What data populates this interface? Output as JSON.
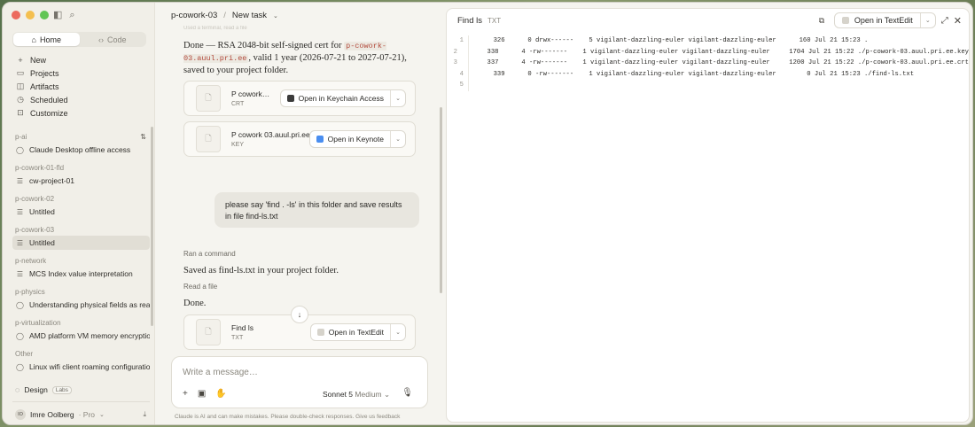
{
  "sidebar": {
    "tabs": {
      "home": "Home",
      "code": "Code"
    },
    "nav": [
      {
        "icon": "plus-icon",
        "glyph": "+",
        "label": "New"
      },
      {
        "icon": "folder-icon",
        "glyph": "▭",
        "label": "Projects"
      },
      {
        "icon": "artifacts-icon",
        "glyph": "◫",
        "label": "Artifacts"
      },
      {
        "icon": "clock-icon",
        "glyph": "◷",
        "label": "Scheduled"
      },
      {
        "icon": "customize-icon",
        "glyph": "⊡",
        "label": "Customize"
      }
    ],
    "groups": [
      {
        "label": "p-ai",
        "items": [
          {
            "icon": "chat-icon",
            "label": "Claude Desktop offline access"
          }
        ]
      },
      {
        "label": "p-cowork-01-fld",
        "items": [
          {
            "icon": "task-icon",
            "label": "cw-project-01"
          }
        ]
      },
      {
        "label": "p-cowork-02",
        "items": [
          {
            "icon": "task-icon",
            "label": "Untitled"
          }
        ]
      },
      {
        "label": "p-cowork-03",
        "items": [
          {
            "icon": "task-icon",
            "label": "Untitled",
            "selected": true
          }
        ]
      },
      {
        "label": "p-network",
        "items": [
          {
            "icon": "task-icon",
            "label": "MCS Index value interpretation"
          }
        ]
      },
      {
        "label": "p-physics",
        "items": [
          {
            "icon": "chat-icon",
            "label": "Understanding physical fields as real"
          }
        ]
      },
      {
        "label": "p-virtualization",
        "items": [
          {
            "icon": "chat-icon",
            "label": "AMD platform VM memory encryption"
          }
        ]
      },
      {
        "label": "Other",
        "items": [
          {
            "icon": "chat-icon",
            "label": "Linux wifi client roaming configuration"
          }
        ]
      }
    ],
    "design": {
      "label": "Design",
      "badge": "Labs"
    },
    "user": {
      "initials": "IO",
      "name": "Imre Oolberg",
      "plan": "· Pro"
    }
  },
  "chat": {
    "breadcrumb": {
      "project": "p-cowork-03",
      "separator": "/",
      "task": "New task"
    },
    "faded_top": "Used a terminal, read a file",
    "reply1": {
      "text_a": "Done — RSA 2048-bit self-signed cert for ",
      "code": "p-cowork-03.auul.pri.ee",
      "text_b": ", valid 1 year (2026-07-21 to 2027-07-21), saved to your project folder."
    },
    "files": [
      {
        "name": "P cowork…",
        "type": "CRT",
        "open_label": "Open in Keychain Access",
        "app_color": "#3b3b3b"
      },
      {
        "name": "P cowork 03.auul.pri.ee",
        "type": "KEY",
        "open_label": "Open in Keynote",
        "app_color": "#4a8ef0"
      },
      {
        "name": "Find ls",
        "type": "TXT",
        "open_label": "Open in TextEdit",
        "app_color": "#d6d3cb"
      }
    ],
    "user_message": "please say 'find . -ls' in this folder and save results in file find-ls.txt",
    "ran_command": "Ran a command",
    "saved_text": "Saved as find-ls.txt in your project folder.",
    "read_file": "Read a file",
    "done_text": "Done.",
    "composer": {
      "placeholder": "Write a message…",
      "model": "Sonnet 5",
      "effort": "Medium"
    },
    "disclaimer": "Claude is AI and can make mistakes. Please double-check responses. Give us feedback"
  },
  "viewer": {
    "title": "Find ls",
    "type": "TXT",
    "open_label": "Open in TextEdit",
    "lines": [
      {
        "n": "1",
        "text": "     326      0 drwx------    5 vigilant-dazzling-euler vigilant-dazzling-euler      160 Jul 21 15:23 ."
      },
      {
        "n": "2",
        "text": "     338      4 -rw-------    1 vigilant-dazzling-euler vigilant-dazzling-euler     1704 Jul 21 15:22 ./p-cowork-03.auul.pri.ee.key"
      },
      {
        "n": "3",
        "text": "     337      4 -rw-------    1 vigilant-dazzling-euler vigilant-dazzling-euler     1200 Jul 21 15:22 ./p-cowork-03.auul.pri.ee.crt"
      },
      {
        "n": "4",
        "text": "     339      0 -rw-------    1 vigilant-dazzling-euler vigilant-dazzling-euler        0 Jul 21 15:23 ./find-ls.txt"
      },
      {
        "n": "5",
        "text": ""
      }
    ]
  }
}
